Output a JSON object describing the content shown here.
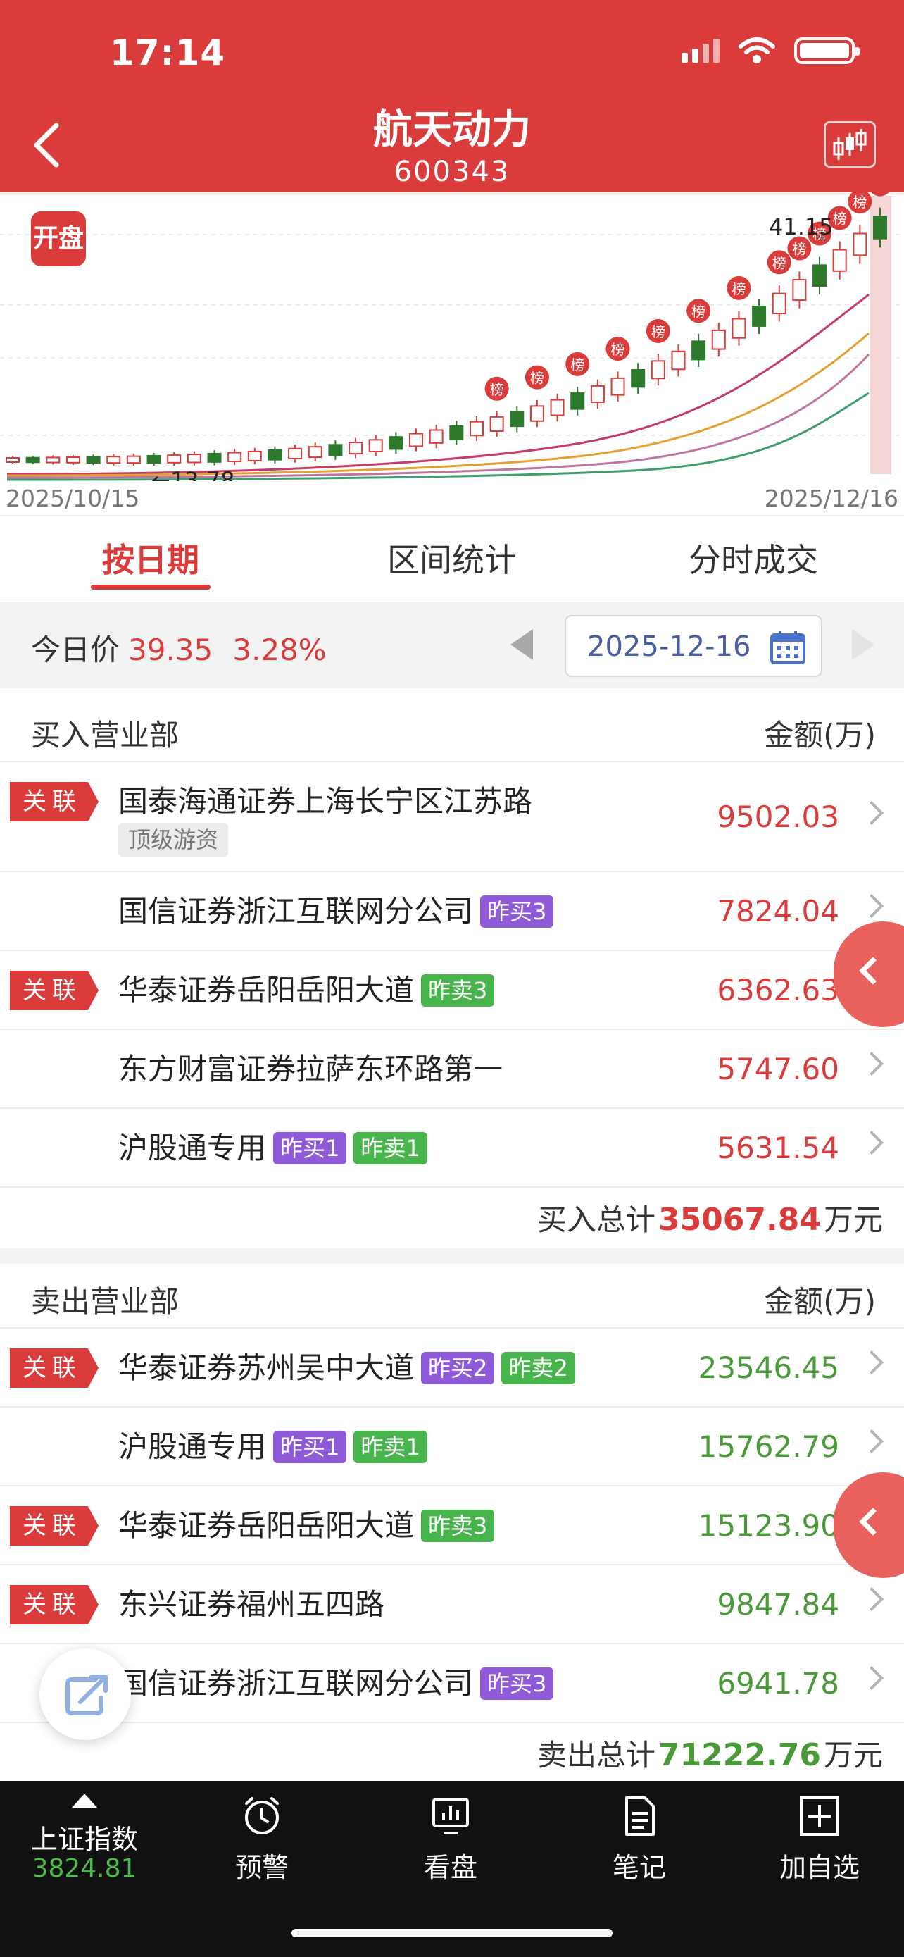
{
  "status": {
    "time": "17:14"
  },
  "header": {
    "title": "航天动力",
    "code": "600343"
  },
  "chart": {
    "badge": "开盘",
    "date_start": "2025/10/15",
    "date_end": "2025/12/16",
    "low_label": "←13.78",
    "high_label": "41.15",
    "marker_label": "榜"
  },
  "tabs": [
    "按日期",
    "区间统计",
    "分时成交"
  ],
  "price": {
    "label": "今日价",
    "value": "39.35",
    "change": "3.28%",
    "date": "2025-12-16"
  },
  "buy": {
    "title": "买入营业部",
    "amount_header": "金额(万)",
    "rows": [
      {
        "tag": "关联",
        "name": "国泰海通证券上海长宁区江苏路",
        "sub": "顶级游资",
        "amount": "9502.03"
      },
      {
        "tag": "",
        "name": "国信证券浙江互联网分公司",
        "badge1": "昨买3",
        "amount": "7824.04"
      },
      {
        "tag": "关联",
        "name": "华泰证券岳阳岳阳大道",
        "badge2": "昨卖3",
        "amount": "6362.63"
      },
      {
        "tag": "",
        "name": "东方财富证券拉萨东环路第一",
        "amount": "5747.60"
      },
      {
        "tag": "",
        "name": "沪股通专用",
        "badge1": "昨买1",
        "badge2": "昨卖1",
        "amount": "5631.54"
      }
    ],
    "total_label": "买入总计",
    "total_value": "35067.84",
    "total_unit": "万元"
  },
  "sell": {
    "title": "卖出营业部",
    "amount_header": "金额(万)",
    "rows": [
      {
        "tag": "关联",
        "name": "华泰证券苏州吴中大道",
        "badge1": "昨买2",
        "badge2": "昨卖2",
        "amount": "23546.45"
      },
      {
        "tag": "",
        "name": "沪股通专用",
        "badge1": "昨买1",
        "badge2": "昨卖1",
        "amount": "15762.79"
      },
      {
        "tag": "关联",
        "name": "华泰证券岳阳岳阳大道",
        "badge2": "昨卖3",
        "amount": "15123.90"
      },
      {
        "tag": "关联",
        "name": "东兴证券福州五四路",
        "amount": "9847.84"
      },
      {
        "tag": "",
        "name": "国信证券浙江互联网分公司",
        "badge1": "昨买3",
        "amount": "6941.78"
      }
    ],
    "total_label": "卖出总计",
    "total_value": "71222.76",
    "total_unit": "万元"
  },
  "nav": {
    "index_name": "上证指数",
    "index_value": "3824.81",
    "items": [
      "预警",
      "看盘",
      "笔记",
      "加自选"
    ]
  },
  "colors": {
    "primary": "#d93c3a",
    "up": "#d93c3a",
    "down": "#4a9a3a",
    "buy_badge": "#8e5ad8",
    "sell_badge": "#48b44c"
  }
}
